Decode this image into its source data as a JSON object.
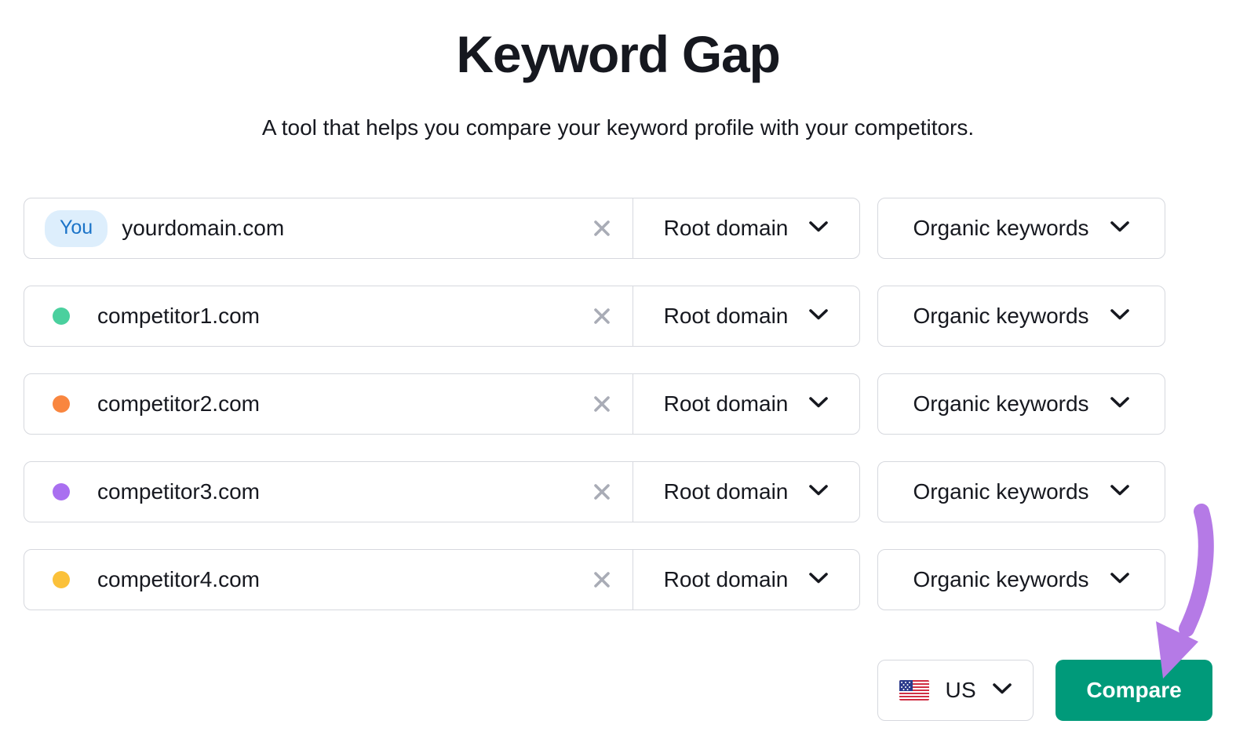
{
  "header": {
    "title": "Keyword Gap",
    "subtitle": "A tool that helps you compare your keyword profile with your competitors."
  },
  "colors": {
    "accent_teal": "#009a7a",
    "badge_bg": "#ddeefc",
    "badge_text": "#1a73c8",
    "annotation_purple": "#b57ae6",
    "border": "#d6d8de",
    "text": "#16181f",
    "clear_icon": "#a9acb6"
  },
  "rows": [
    {
      "marker_type": "badge",
      "badge_label": "You",
      "dot_color": "",
      "domain": "yourdomain.com",
      "clear_icon": "close-icon",
      "scope": "Root domain",
      "metric": "Organic keywords"
    },
    {
      "marker_type": "dot",
      "badge_label": "",
      "dot_color": "#4ad09e",
      "domain": "competitor1.com",
      "clear_icon": "close-icon",
      "scope": "Root domain",
      "metric": "Organic keywords"
    },
    {
      "marker_type": "dot",
      "badge_label": "",
      "dot_color": "#f9863f",
      "domain": "competitor2.com",
      "clear_icon": "close-icon",
      "scope": "Root domain",
      "metric": "Organic keywords"
    },
    {
      "marker_type": "dot",
      "badge_label": "",
      "dot_color": "#a96ff0",
      "domain": "competitor3.com",
      "clear_icon": "close-icon",
      "scope": "Root domain",
      "metric": "Organic keywords"
    },
    {
      "marker_type": "dot",
      "badge_label": "",
      "dot_color": "#fbc13a",
      "domain": "competitor4.com",
      "clear_icon": "close-icon",
      "scope": "Root domain",
      "metric": "Organic keywords"
    }
  ],
  "footer": {
    "country": "US",
    "country_flag_icon": "us-flag-icon",
    "country_chevron_icon": "chevron-down-icon",
    "compare_label": "Compare"
  },
  "annotation": {
    "type": "curved-arrow",
    "color": "#b57ae6",
    "points_to": "compare-button"
  }
}
